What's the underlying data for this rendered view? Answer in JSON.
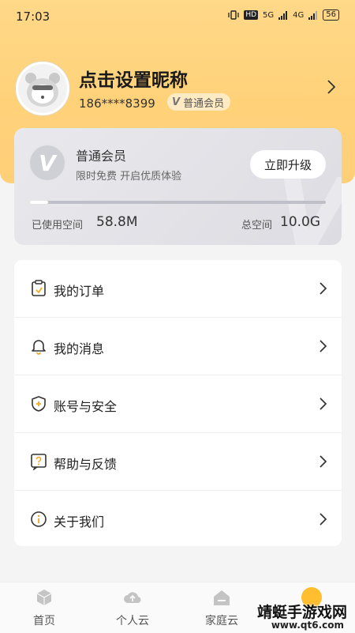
{
  "status_bar": {
    "time": "17:03",
    "battery": "56",
    "network_1": "5G",
    "network_2": "4G",
    "hd": "HD"
  },
  "profile": {
    "nickname": "点击设置昵称",
    "phone": "186****8399",
    "level_badge": "普通会员",
    "badge_icon": "V"
  },
  "vip_card": {
    "title": "普通会员",
    "subtitle": "限时免费 开启优质体验",
    "upgrade_label": "立即升级",
    "logo_letter": "V",
    "storage_used_fraction": 0.06,
    "used_label": "已使用空间",
    "used_value": "58.8M",
    "total_label": "总空间",
    "total_value": "10.0G"
  },
  "menu": {
    "items": [
      {
        "label": "我的订单",
        "icon": "order-icon"
      },
      {
        "label": "我的消息",
        "icon": "bell-icon"
      },
      {
        "label": "账号与安全",
        "icon": "shield-icon"
      },
      {
        "label": "帮助与反馈",
        "icon": "help-icon"
      },
      {
        "label": "关于我们",
        "icon": "info-icon"
      }
    ]
  },
  "tabbar": {
    "tabs": [
      {
        "label": "首页",
        "icon": "cube-icon"
      },
      {
        "label": "个人云",
        "icon": "cloud-upload-icon"
      },
      {
        "label": "家庭云",
        "icon": "house-icon"
      },
      {
        "label": "",
        "icon": "mascot-icon"
      }
    ]
  },
  "watermark": {
    "text": "靖蜓手游戏网",
    "url": "www.qt6.com"
  },
  "colors": {
    "header": "#ffd27a",
    "accent": "#ffbe2e",
    "card": "#e2e2e8"
  }
}
